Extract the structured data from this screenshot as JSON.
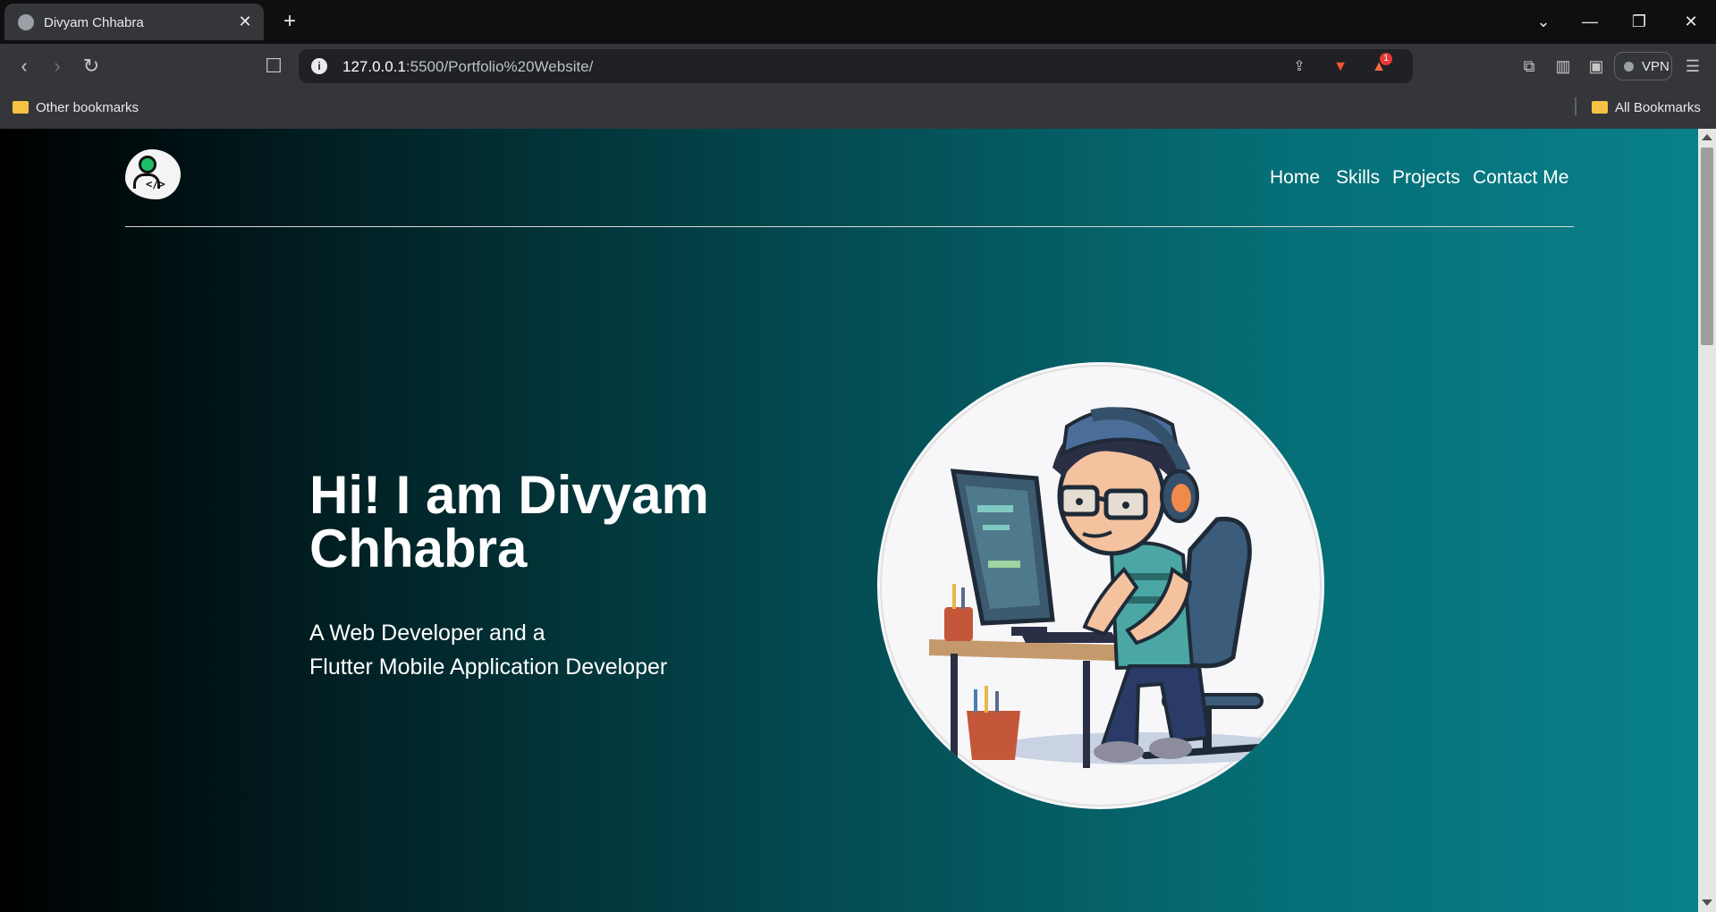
{
  "browser": {
    "tab_title": "Divyam Chhabra",
    "url_host": "127.0.0.1",
    "url_path": ":5500/Portfolio%20Website/",
    "notification_count": "1",
    "vpn_label": "VPN",
    "bookmarks": {
      "other": "Other bookmarks",
      "all": "All Bookmarks"
    }
  },
  "site": {
    "nav": {
      "home": "Home",
      "skills": "Skills",
      "projects": "Projects",
      "contact": "Contact Me"
    },
    "hero": {
      "title_line1": "Hi! I am Divyam",
      "title_line2": "Chhabra",
      "subtitle_line1": "A Web Developer and a",
      "subtitle_line2": "Flutter Mobile Application Developer"
    }
  },
  "icons": {
    "logo": "user-code-logo-icon",
    "illustration": "developer-at-computer-illustration"
  },
  "colors": {
    "gradient_start": "#000000",
    "gradient_end": "#08808a",
    "text": "#ffffff"
  }
}
